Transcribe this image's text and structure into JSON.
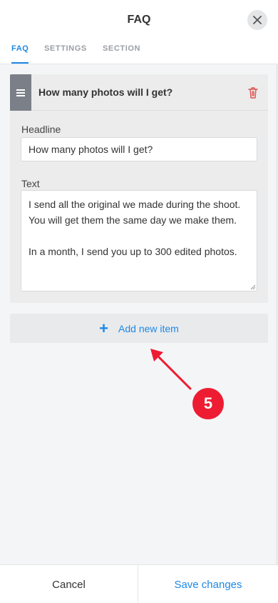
{
  "header": {
    "title": "FAQ"
  },
  "tabs": [
    {
      "label": "FAQ",
      "active": true
    },
    {
      "label": "SETTINGS",
      "active": false
    },
    {
      "label": "SECTION",
      "active": false
    }
  ],
  "faq_item": {
    "title": "How many photos will I get?",
    "headline_label": "Headline",
    "headline_value": "How many photos will I get?",
    "text_label": "Text",
    "text_value": "I send all the original we made during the shoot. You will get them the same day we make them.\n\nIn a month, I send you up to 300 edited photos."
  },
  "add_item": {
    "icon": "+",
    "label": "Add new item"
  },
  "annotation": {
    "step": "5"
  },
  "footer": {
    "cancel_label": "Cancel",
    "save_label": "Save changes"
  },
  "colors": {
    "accent": "#1e88e5",
    "badge": "#ee1c32",
    "delete": "#d9534f"
  }
}
